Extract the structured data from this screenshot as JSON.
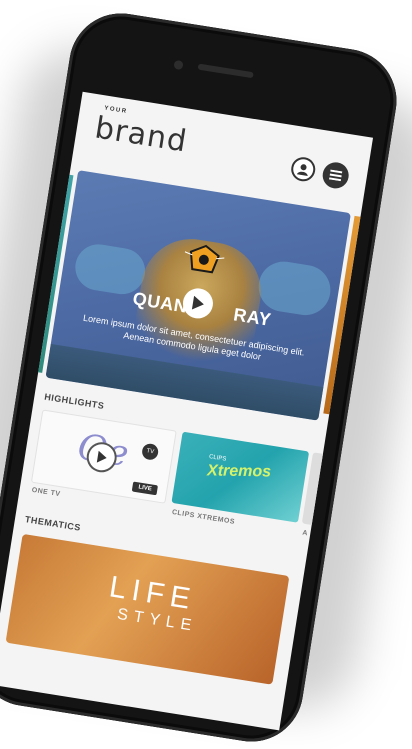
{
  "brand": {
    "small": "YOUR",
    "name": "brand"
  },
  "header": {
    "user_icon": "user-icon",
    "menu_icon": "menu-icon"
  },
  "hero": {
    "title_left": "QUAN",
    "title_right": "RAY",
    "description": "Lorem ipsum dolor sit amet, consectetuer adipiscing elit. Aenean commodo ligula eget dolor"
  },
  "highlights": {
    "title": "HIGHLIGHTS",
    "items": [
      {
        "label": "ONE TV",
        "badge": "LIVE",
        "tv": "TV"
      },
      {
        "label": "CLIPS XTREMOS",
        "logo": "Xtremos",
        "logo_small": "CLIPS"
      },
      {
        "label": "A"
      }
    ]
  },
  "thematics": {
    "title": "THEMATICS",
    "items": [
      {
        "line1": "LIFE",
        "line2": "STYLE"
      }
    ]
  },
  "colors": {
    "frame": "#141414",
    "accent": "#333333",
    "screen": "#f4f4f4"
  }
}
